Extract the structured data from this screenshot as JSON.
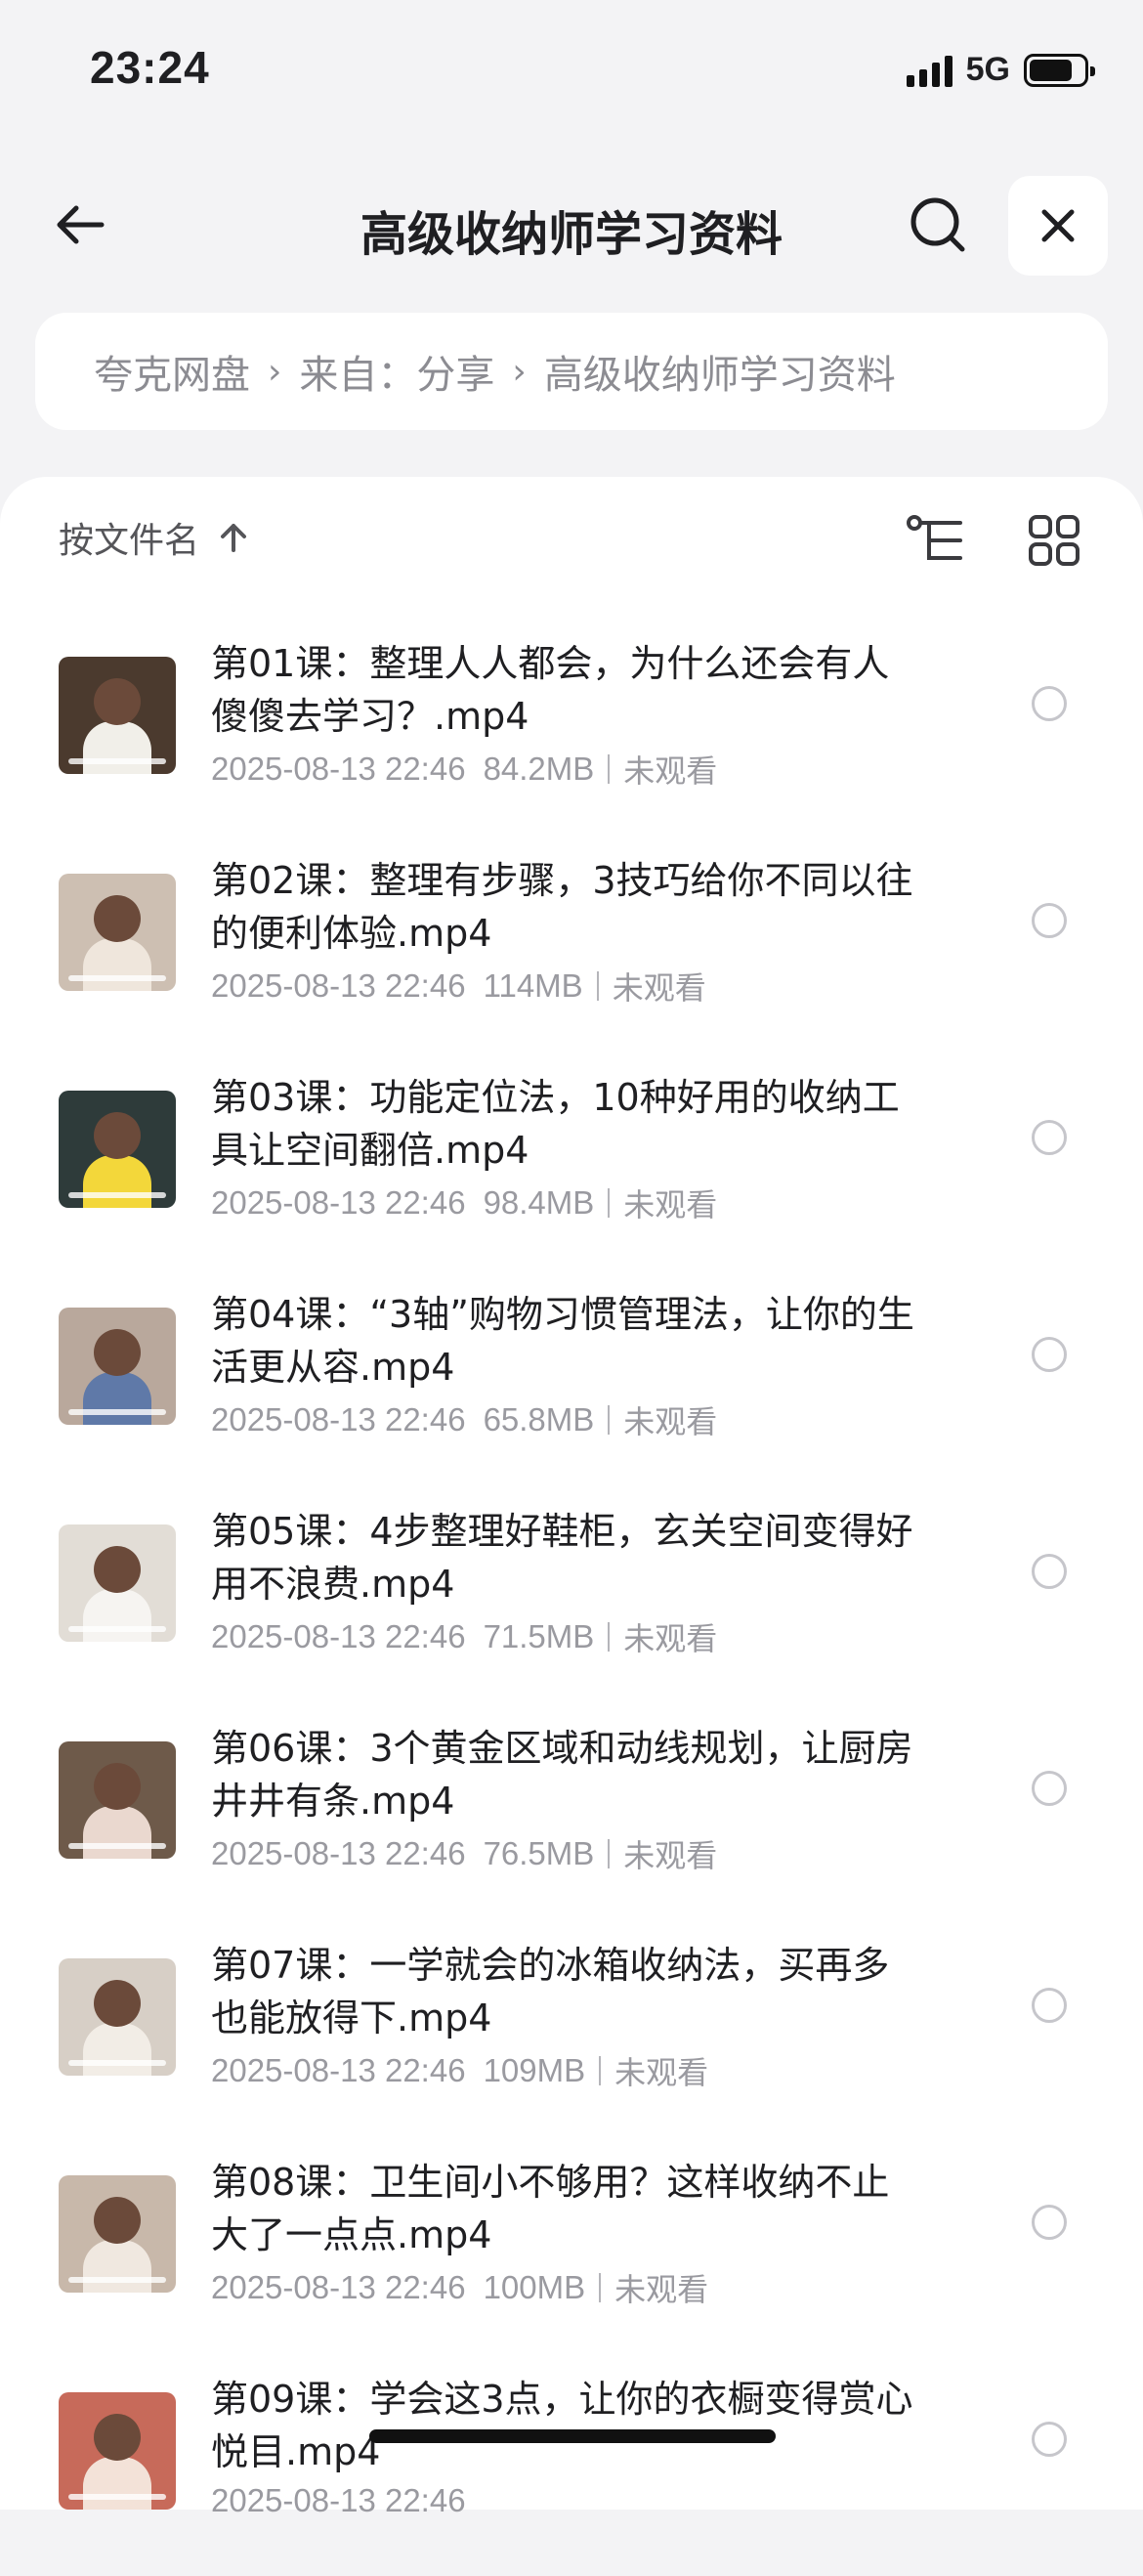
{
  "status_bar": {
    "time": "23:24",
    "network": "5G",
    "signal_bars": 4,
    "battery_level": 0.8
  },
  "nav": {
    "title": "高级收纳师学习资料",
    "back_icon": "arrow-left-icon",
    "search_icon": "search-icon",
    "close_icon": "close-icon"
  },
  "breadcrumb": {
    "items": [
      "夸克网盘",
      "来自：分享",
      "高级收纳师学习资料"
    ],
    "separator": "›"
  },
  "sort": {
    "label": "按文件名",
    "direction_icon": "arrow-up-icon",
    "tree_icon": "tree-view-icon",
    "grid_icon": "grid-view-icon"
  },
  "files": [
    {
      "name": "第01课：整理人人都会，为什么还会有人傻傻去学习？.mp4",
      "date": "2025-08-13 22:46",
      "size": "84.2MB",
      "status": "未观看",
      "thumb_bg": "#4b3a2e",
      "thumb_body": "#f1efe9"
    },
    {
      "name": "第02课：整理有步骤，3技巧给你不同以往的便利体验.mp4",
      "date": "2025-08-13 22:46",
      "size": "114MB",
      "status": "未观看",
      "thumb_bg": "#cdbfb2",
      "thumb_body": "#efe6dc"
    },
    {
      "name": "第03课：功能定位法，10种好用的收纳工具让空间翻倍.mp4",
      "date": "2025-08-13 22:46",
      "size": "98.4MB",
      "status": "未观看",
      "thumb_bg": "#2e3b3a",
      "thumb_body": "#f3d73a"
    },
    {
      "name": "第04课：“3轴”购物习惯管理法，让你的生活更从容.mp4",
      "date": "2025-08-13 22:46",
      "size": "65.8MB",
      "status": "未观看",
      "thumb_bg": "#b9a89c",
      "thumb_body": "#5f79a8"
    },
    {
      "name": "第05课：4步整理好鞋柜，玄关空间变得好用不浪费.mp4",
      "date": "2025-08-13 22:46",
      "size": "71.5MB",
      "status": "未观看",
      "thumb_bg": "#e2ddd6",
      "thumb_body": "#f6f4f1"
    },
    {
      "name": "第06课：3个黄金区域和动线规划，让厨房井井有条.mp4",
      "date": "2025-08-13 22:46",
      "size": "76.5MB",
      "status": "未观看",
      "thumb_bg": "#6e5a4a",
      "thumb_body": "#ead8cf"
    },
    {
      "name": "第07课：一学就会的冰箱收纳法，买再多也能放得下.mp4",
      "date": "2025-08-13 22:46",
      "size": "109MB",
      "status": "未观看",
      "thumb_bg": "#d7cfc6",
      "thumb_body": "#f2ede6"
    },
    {
      "name": "第08课：卫生间小不够用？这样收纳不止大了一点点.mp4",
      "date": "2025-08-13 22:46",
      "size": "100MB",
      "status": "未观看",
      "thumb_bg": "#c8b8aa",
      "thumb_body": "#f0e8e0"
    },
    {
      "name": "第09课：学会这3点，让你的衣橱变得赏心悦目.mp4",
      "date": "2025-08-13 22:46",
      "size": "",
      "status": "",
      "thumb_bg": "#c76a5a",
      "thumb_body": "#f3e2d8"
    }
  ]
}
